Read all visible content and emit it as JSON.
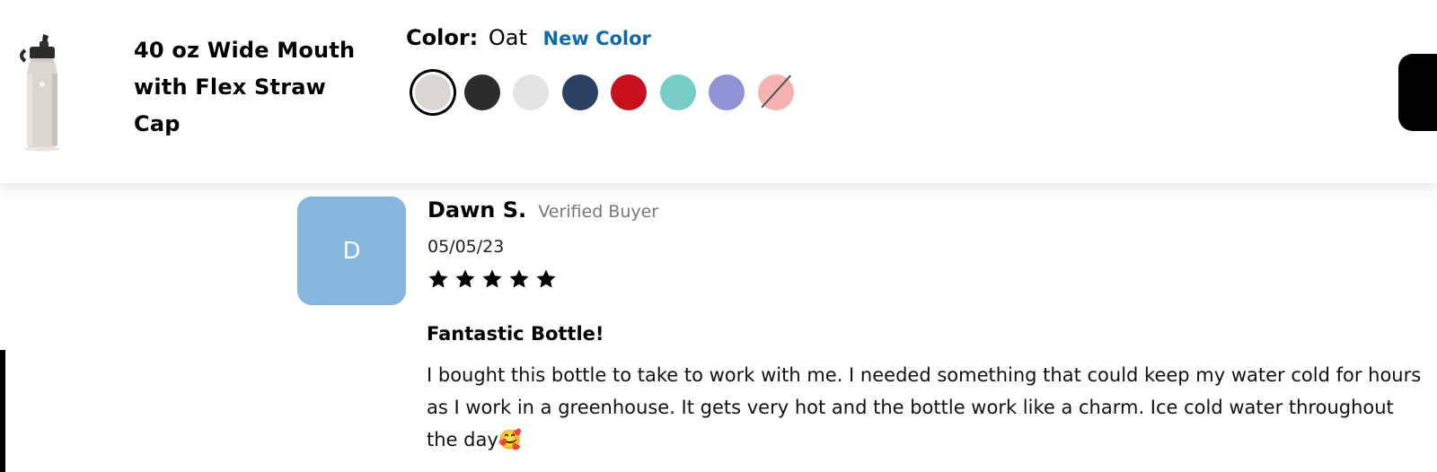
{
  "product": {
    "title": "40 oz Wide Mouth with Flex Straw Cap",
    "color_label": "Color:",
    "color_value": "Oat",
    "new_color_label": "New Color",
    "new_color_accent": "#106aa5",
    "swatches": [
      {
        "name": "oat",
        "color": "#dcd6d2",
        "selected": true
      },
      {
        "name": "black",
        "color": "#2c2c2c"
      },
      {
        "name": "white",
        "color": "#e4e4e4"
      },
      {
        "name": "indigo",
        "color": "#2a4163"
      },
      {
        "name": "red",
        "color": "#c8101e"
      },
      {
        "name": "seafoam",
        "color": "#79cdc8"
      },
      {
        "name": "lupine",
        "color": "#8f93d3"
      },
      {
        "name": "pink",
        "color": "#f3a5a3",
        "unavailable": true
      }
    ],
    "cart_button_icon": "dark-rounded-button"
  },
  "review": {
    "avatar_initial": "D",
    "avatar_color": "#84b6de",
    "reviewer_name": "Dawn S.",
    "verified_label": "Verified Buyer",
    "date": "05/05/23",
    "rating": 5,
    "rating_max": 5,
    "title": "Fantastic Bottle!",
    "body": "I bought this bottle to take to work with me. I needed something that could keep my water cold for hours as I work in a greenhouse. It gets very hot and the bottle work like a charm. Ice cold water throughout the day🥰"
  }
}
